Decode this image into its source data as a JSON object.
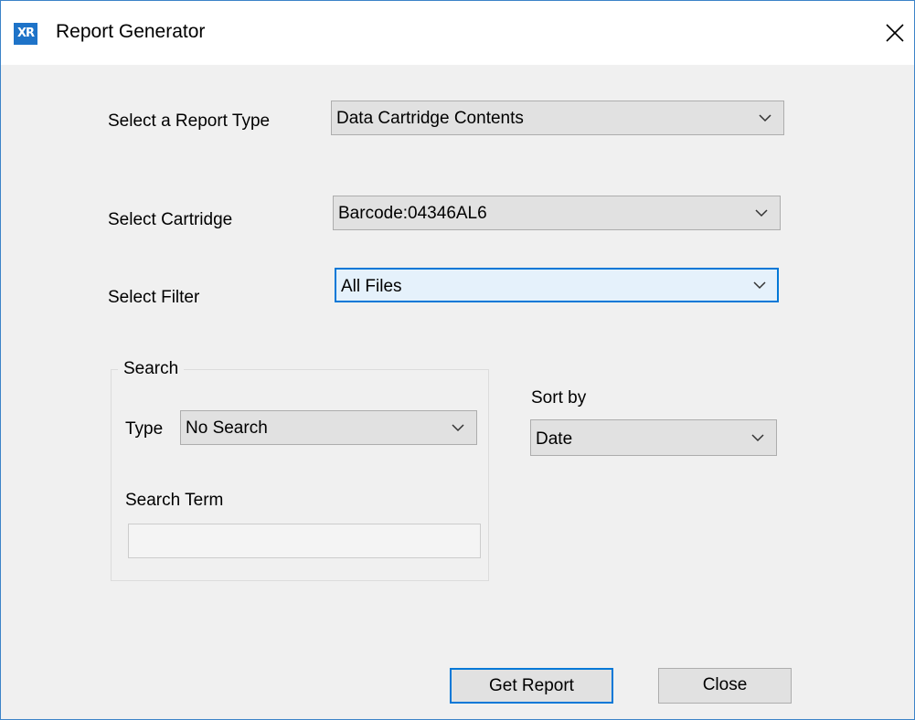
{
  "window": {
    "icon_text": "XR",
    "title": "Report Generator"
  },
  "report_type": {
    "label": "Select a Report Type",
    "value": "Data Cartridge Contents"
  },
  "cartridge": {
    "label": "Select Cartridge",
    "value": "Barcode:04346AL6"
  },
  "filter": {
    "label": "Select Filter",
    "value": "All Files"
  },
  "search": {
    "group_label": "Search",
    "type_label": "Type",
    "type_value": "No Search",
    "term_label": "Search Term",
    "term_value": ""
  },
  "sort": {
    "label": "Sort by",
    "value": "Date"
  },
  "buttons": {
    "get_report": "Get Report",
    "close": "Close"
  },
  "colors": {
    "focus_border": "#0078d7",
    "title_icon_bg": "#1e73c8",
    "window_bg": "#f0f0f0"
  },
  "icons": [
    "app-logo-icon",
    "close-icon",
    "chevron-down-icon"
  ]
}
